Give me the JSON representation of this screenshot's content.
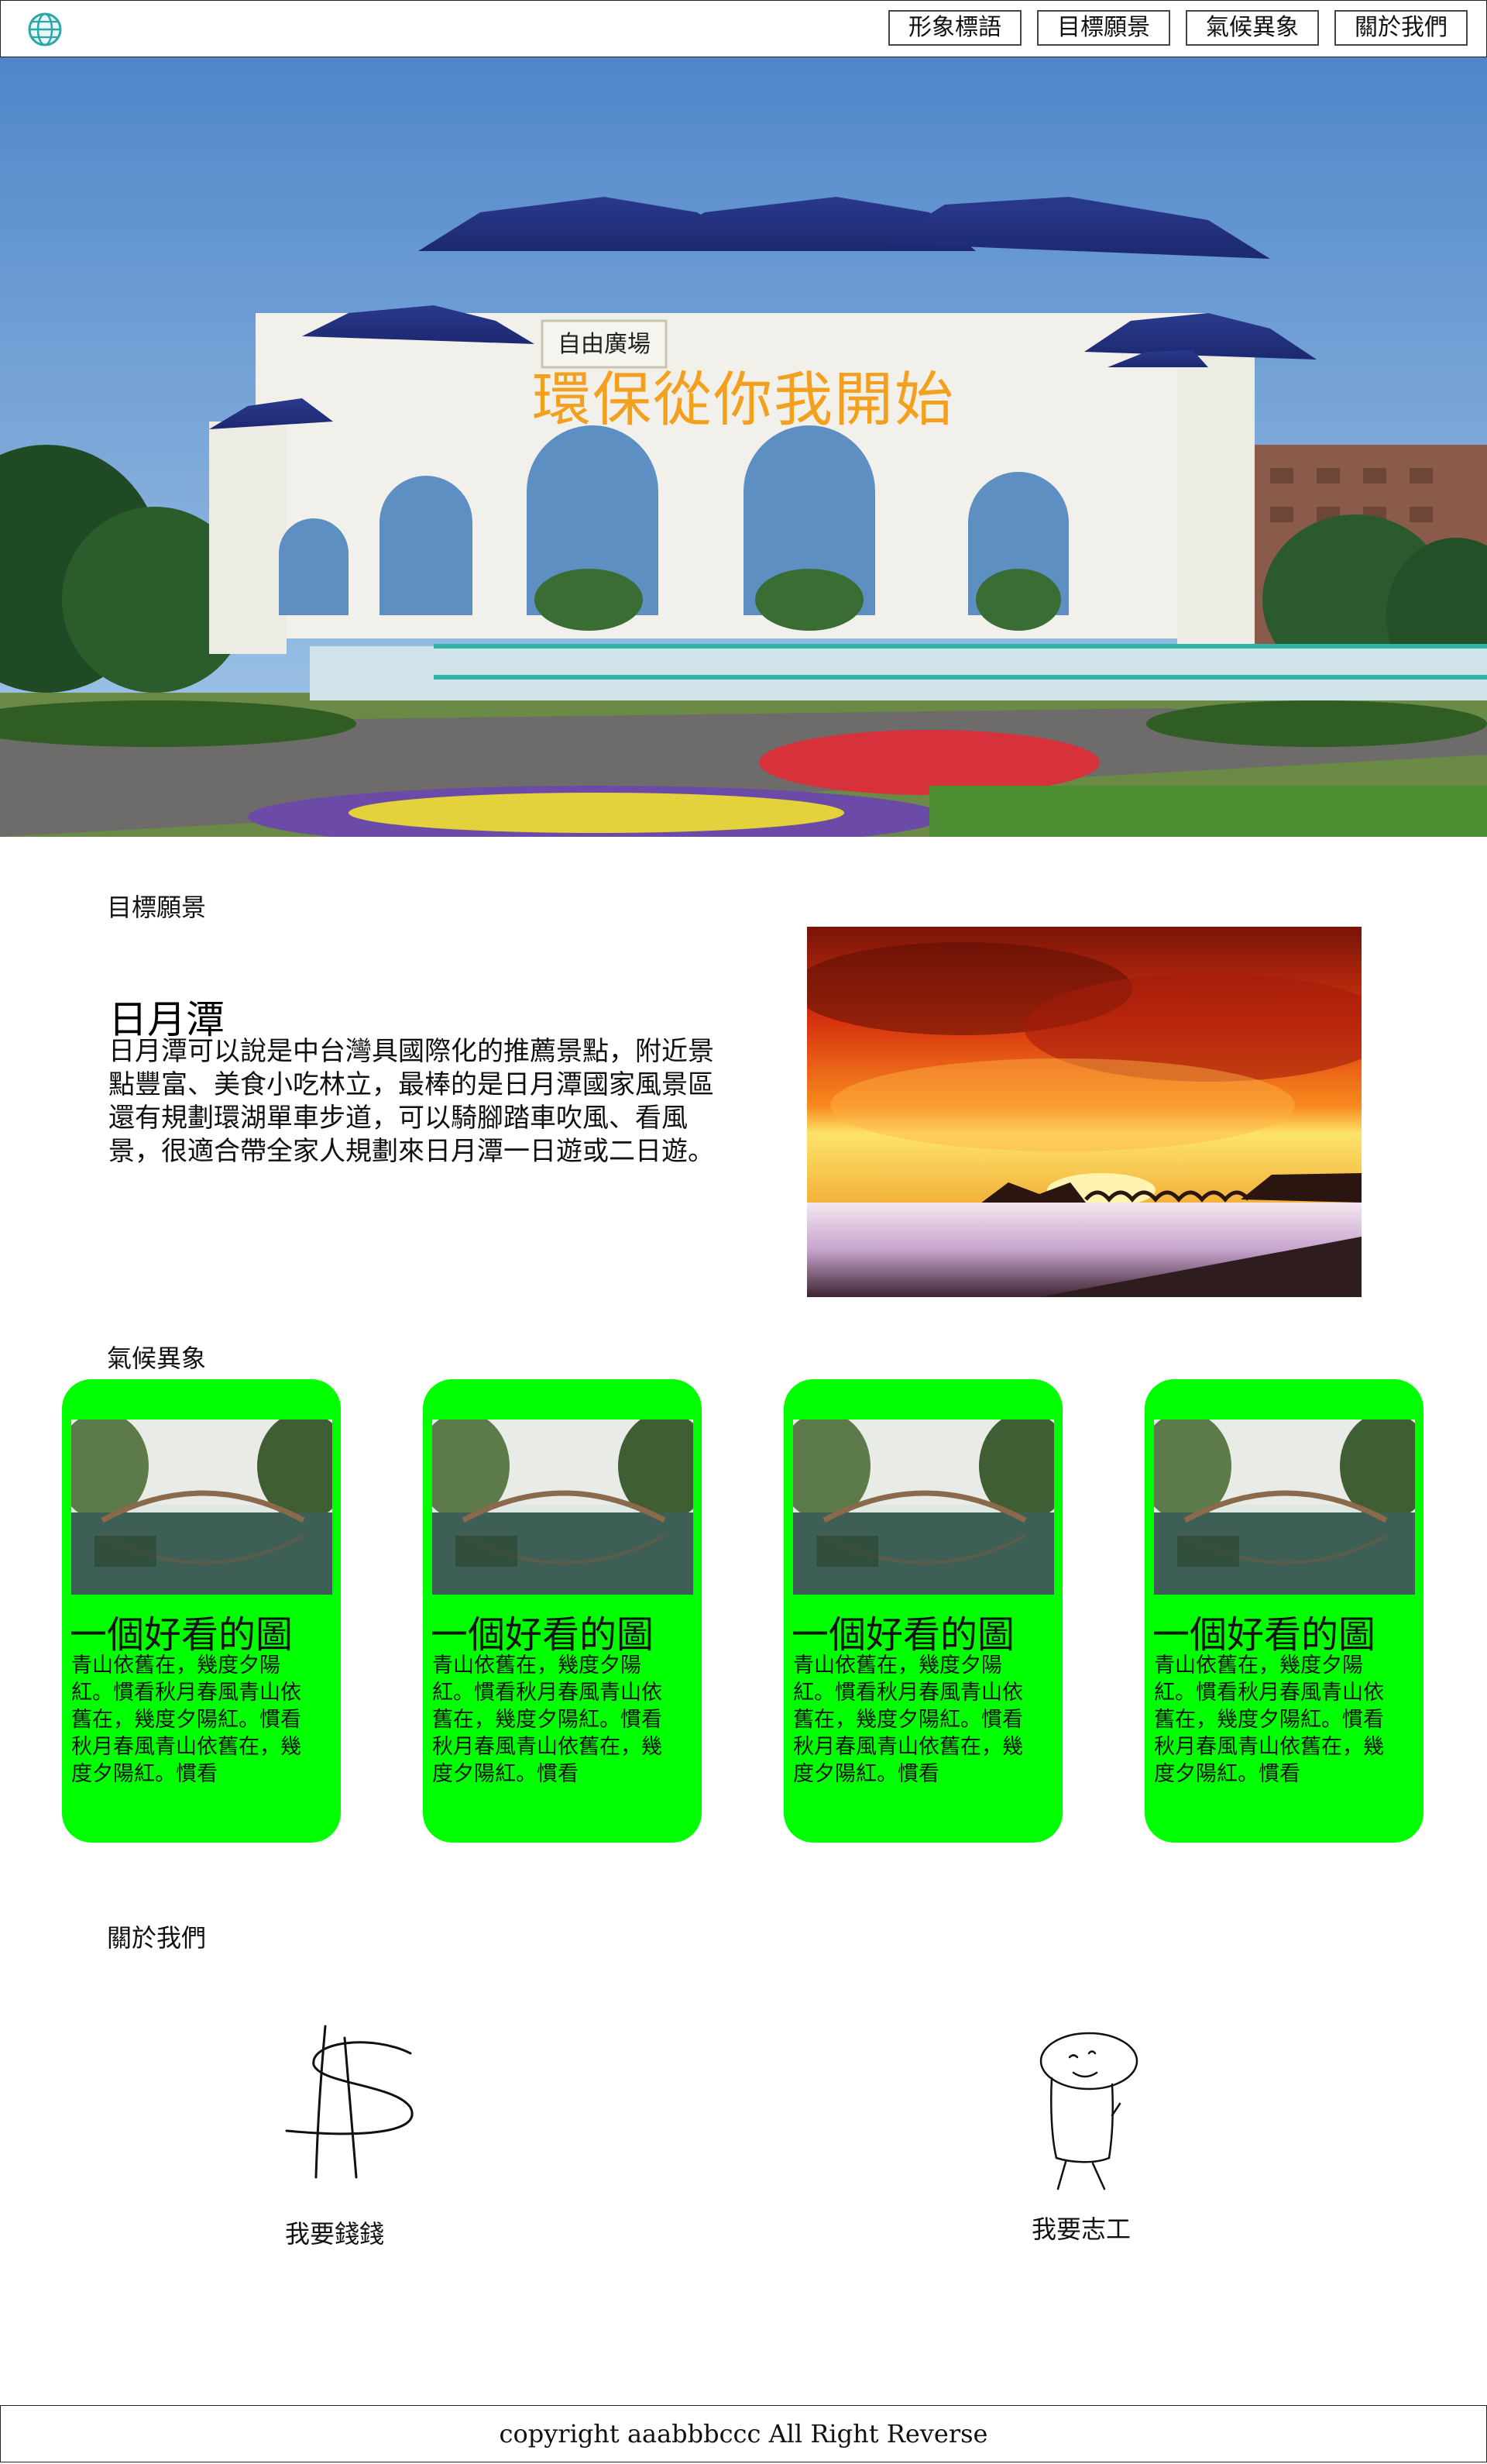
{
  "header": {
    "logo_icon": "globe-icon",
    "nav": [
      {
        "label": "形象標語"
      },
      {
        "label": "目標願景"
      },
      {
        "label": "氣候異象"
      },
      {
        "label": "關於我們"
      }
    ]
  },
  "hero": {
    "title": "環保從你我開始",
    "title_color": "#f2a01e",
    "gate_plaque": "自由廣場"
  },
  "goal": {
    "section_label": "目標願景",
    "heading": "日月潭",
    "text": "日月潭可以說是中台灣具國際化的推薦景點，附近景點豐富、美食小吃林立，最棒的是日月潭國家風景區還有規劃環湖單車步道，可以騎腳踏車吹風、看風景，很適合帶全家人規劃來日月潭一日遊或二日遊。"
  },
  "climate": {
    "section_label": "氣候異象",
    "card_color": "#00ff00",
    "cards": [
      {
        "title": "一個好看的圖",
        "text": "青山依舊在，幾度夕陽紅。慣看秋月春風青山依舊在，幾度夕陽紅。慣看秋月春風青山依舊在，幾度夕陽紅。慣看"
      },
      {
        "title": "一個好看的圖",
        "text": "青山依舊在，幾度夕陽紅。慣看秋月春風青山依舊在，幾度夕陽紅。慣看秋月春風青山依舊在，幾度夕陽紅。慣看"
      },
      {
        "title": "一個好看的圖",
        "text": "青山依舊在，幾度夕陽紅。慣看秋月春風青山依舊在，幾度夕陽紅。慣看秋月春風青山依舊在，幾度夕陽紅。慣看"
      },
      {
        "title": "一個好看的圖",
        "text": "青山依舊在，幾度夕陽紅。慣看秋月春風青山依舊在，幾度夕陽紅。慣看秋月春風青山依舊在，幾度夕陽紅。慣看"
      }
    ]
  },
  "about": {
    "section_label": "關於我們",
    "items": [
      {
        "label": "我要錢錢",
        "icon": "dollar-sign-icon"
      },
      {
        "label": "我要志工",
        "icon": "volunteer-figure-icon"
      }
    ]
  },
  "footer": {
    "text": "copyright aaabbbccc All Right Reverse"
  }
}
